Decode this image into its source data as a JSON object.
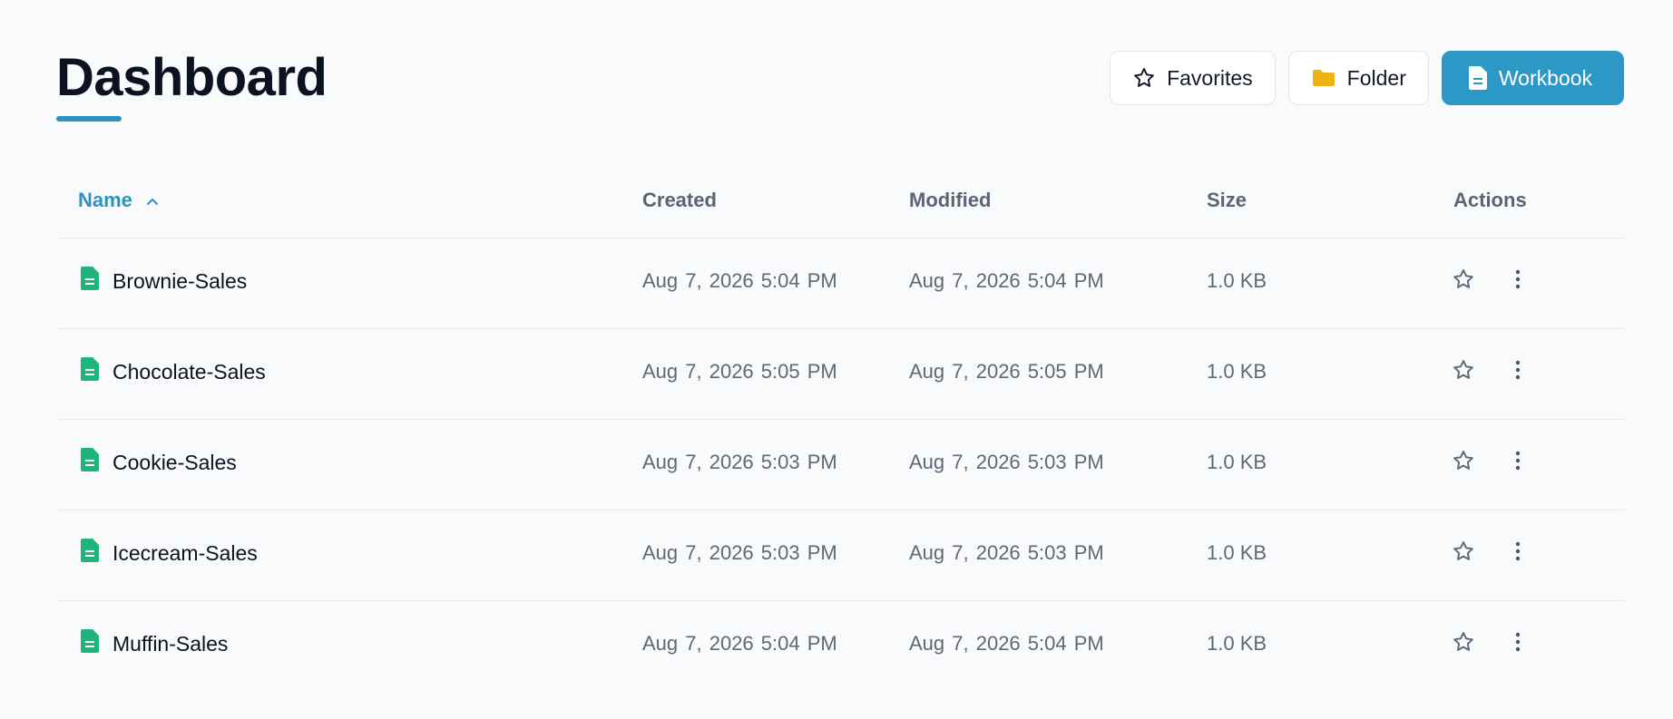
{
  "page": {
    "title": "Dashboard"
  },
  "toolbar": {
    "favorites_label": "Favorites",
    "folder_label": "Folder",
    "workbook_label": "Workbook"
  },
  "table": {
    "columns": {
      "name": "Name",
      "created": "Created",
      "modified": "Modified",
      "size": "Size",
      "actions": "Actions"
    },
    "sort": {
      "column": "name",
      "direction": "ascending",
      "icon": "chevron-up-icon"
    },
    "rows": [
      {
        "name": "Brownie-Sales",
        "created": "Aug 7, 2026  5:04 PM",
        "modified": "Aug 7, 2026  5:04 PM",
        "size": "1.0 KB"
      },
      {
        "name": "Chocolate-Sales",
        "created": "Aug 7, 2026  5:05 PM",
        "modified": "Aug 7, 2026  5:05 PM",
        "size": "1.0 KB"
      },
      {
        "name": "Cookie-Sales",
        "created": "Aug 7, 2026  5:03 PM",
        "modified": "Aug 7, 2026  5:03 PM",
        "size": "1.0 KB"
      },
      {
        "name": "Icecream-Sales",
        "created": "Aug 7, 2026  5:03 PM",
        "modified": "Aug 7, 2026  5:03 PM",
        "size": "1.0 KB"
      },
      {
        "name": "Muffin-Sales",
        "created": "Aug 7, 2026  5:04 PM",
        "modified": "Aug 7, 2026  5:04 PM",
        "size": "1.0 KB"
      }
    ]
  },
  "icons": {
    "favorites": "star-icon",
    "folder": "folder-icon",
    "workbook": "document-icon",
    "file": "spreadsheet-file-icon",
    "row_favorite": "star-outline-icon",
    "row_more": "more-vertical-icon"
  },
  "colors": {
    "accent": "#2c98c6",
    "file_icon": "#1fb57a",
    "folder_icon": "#efb414",
    "muted_text": "#5f6876",
    "title_text": "#0b1220",
    "background": "#f9fafc"
  }
}
